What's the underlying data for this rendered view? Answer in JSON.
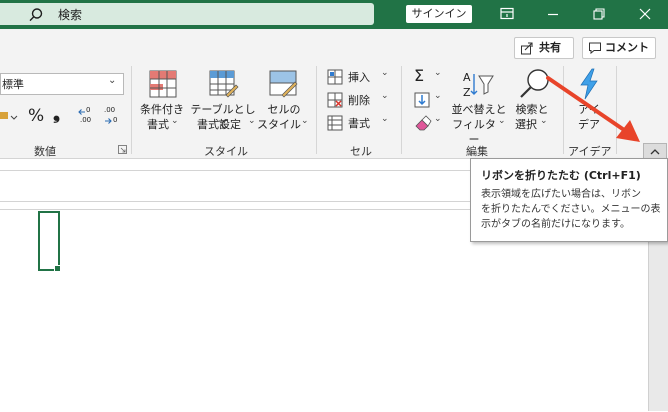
{
  "titlebar": {
    "search_placeholder": "検索",
    "signin_label": "サインイン"
  },
  "header": {
    "share_label": "共有",
    "comment_label": "コメント"
  },
  "ribbon": {
    "number": {
      "format_value": "標準",
      "percent": "%",
      "comma": "❟",
      "inc_decimal": ".00",
      "dec_decimal": ".00",
      "group_label": "数値"
    },
    "style": {
      "conditional_line1": "条件付き",
      "conditional_line2": "書式",
      "table_line1": "テーブルとして",
      "table_line2": "書式設定",
      "cell_line1": "セルの",
      "cell_line2": "スタイル",
      "group_label": "スタイル"
    },
    "cells": {
      "insert_label": "挿入",
      "delete_label": "削除",
      "format_label": "書式",
      "group_label": "セル"
    },
    "edit": {
      "sort_line1": "並べ替えと",
      "sort_line2": "フィルター",
      "find_line1": "検索と",
      "find_line2": "選択",
      "group_label": "編集"
    },
    "ideas": {
      "line1": "アイ",
      "line2": "デア",
      "group_label": "アイデア"
    }
  },
  "tooltip": {
    "title": "リボンを折りたたむ (Ctrl+F1)",
    "line1": "表示領域を広げたい場合は、リボン",
    "line2": "を折りたたんでください。メニューの表",
    "line3": "示がタブの名前だけになります。"
  },
  "colors": {
    "brand_green": "#217346",
    "arrow_red": "#e8442a"
  }
}
